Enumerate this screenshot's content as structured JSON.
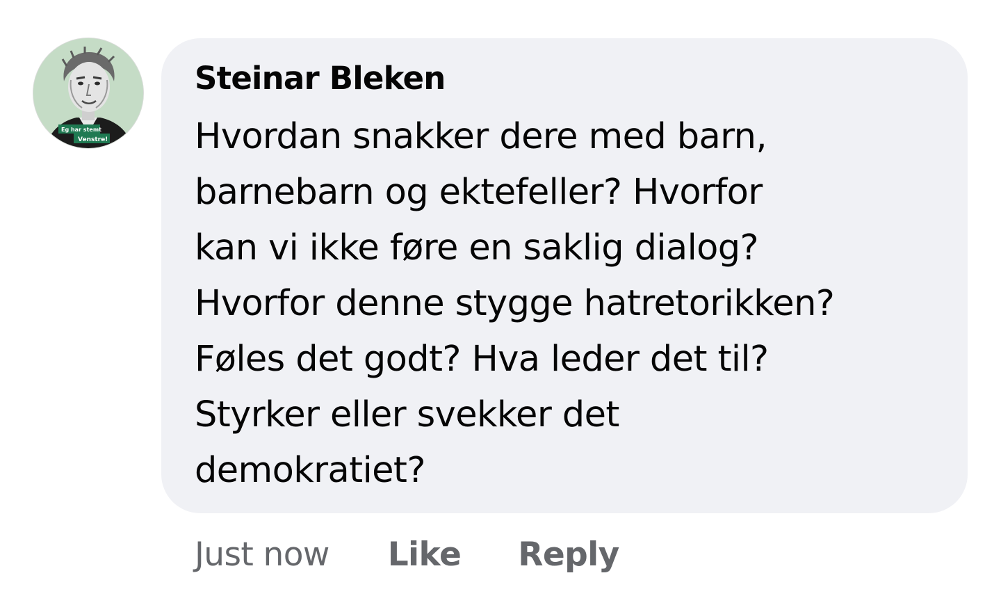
{
  "comment": {
    "author": "Steinar Bleken",
    "avatar_badge": {
      "line1": "Eg har stemt",
      "line2": "Venstre!"
    },
    "lines": [
      "Hvordan snakker dere med barn,",
      "barnebarn og ektefeller? Hvorfor",
      "kan vi ikke føre en saklig dialog?",
      "Hvorfor denne stygge hatretorikken?",
      "Føles det godt? Hva leder det til?",
      "Styrker eller svekker det",
      "demokratiet?"
    ],
    "timestamp": "Just now",
    "like_label": "Like",
    "reply_label": "Reply"
  },
  "colors": {
    "bubble_bg": "#f0f1f5",
    "text": "#050505",
    "meta": "#65676b",
    "avatar_bg": "#c5dcc6",
    "badge_green": "#1f7a52"
  }
}
